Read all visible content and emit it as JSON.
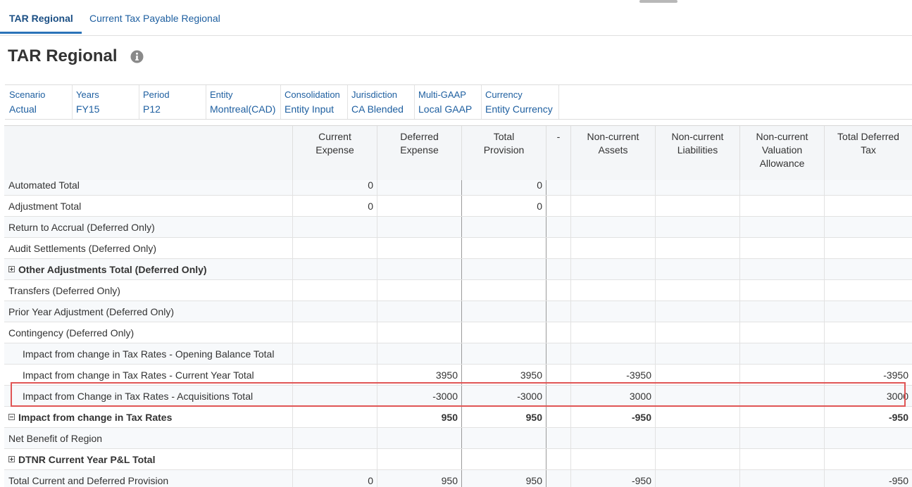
{
  "tabs": [
    {
      "label": "TAR Regional",
      "active": true
    },
    {
      "label": "Current Tax Payable Regional",
      "active": false
    }
  ],
  "page_title": "TAR Regional",
  "pov": [
    {
      "label": "Scenario",
      "value": "Actual"
    },
    {
      "label": "Years",
      "value": "FY15"
    },
    {
      "label": "Period",
      "value": "P12"
    },
    {
      "label": "Entity",
      "value": "Montreal(CAD)"
    },
    {
      "label": "Consolidation",
      "value": "Entity Input"
    },
    {
      "label": "Jurisdiction",
      "value": "CA Blended"
    },
    {
      "label": "Multi-GAAP",
      "value": "Local GAAP"
    },
    {
      "label": "Currency",
      "value": "Entity Currency"
    }
  ],
  "columns": [
    {
      "label": "Current\nExpense"
    },
    {
      "label": "Deferred\nExpense"
    },
    {
      "label": "Total\nProvision"
    },
    {
      "label": "-"
    },
    {
      "label": "Non-current\nAssets"
    },
    {
      "label": "Non-current\nLiabilities"
    },
    {
      "label": "Non-current\nValuation\nAllowance"
    },
    {
      "label": "Total Deferred\nTax"
    }
  ],
  "rows": [
    {
      "label": "Automated Total",
      "values": [
        "0",
        "",
        "0",
        "",
        "",
        "",
        "",
        ""
      ]
    },
    {
      "label": "Adjustment Total",
      "values": [
        "0",
        "",
        "0",
        "",
        "",
        "",
        "",
        ""
      ]
    },
    {
      "label": "Return to Accrual (Deferred Only)",
      "values": [
        "",
        "",
        "",
        "",
        "",
        "",
        "",
        ""
      ]
    },
    {
      "label": "Audit Settlements (Deferred Only)",
      "values": [
        "",
        "",
        "",
        "",
        "",
        "",
        "",
        ""
      ]
    },
    {
      "label": "Other Adjustments Total (Deferred Only)",
      "bold": true,
      "expander": "plus",
      "values": [
        "",
        "",
        "",
        "",
        "",
        "",
        "",
        ""
      ]
    },
    {
      "label": "Transfers (Deferred Only)",
      "values": [
        "",
        "",
        "",
        "",
        "",
        "",
        "",
        ""
      ]
    },
    {
      "label": "Prior Year Adjustment (Deferred Only)",
      "values": [
        "",
        "",
        "",
        "",
        "",
        "",
        "",
        ""
      ]
    },
    {
      "label": "Contingency (Deferred Only)",
      "values": [
        "",
        "",
        "",
        "",
        "",
        "",
        "",
        ""
      ]
    },
    {
      "label": "Impact from change in Tax Rates - Opening Balance Total",
      "indent": true,
      "values": [
        "",
        "",
        "",
        "",
        "",
        "",
        "",
        ""
      ]
    },
    {
      "label": "Impact from change in Tax Rates - Current Year Total",
      "indent": true,
      "values": [
        "",
        "3950",
        "3950",
        "",
        "-3950",
        "",
        "",
        "-3950"
      ]
    },
    {
      "label": "Impact from Change in Tax Rates - Acquisitions Total",
      "indent": true,
      "highlighted": true,
      "values": [
        "",
        "-3000",
        "-3000",
        "",
        "3000",
        "",
        "",
        "3000"
      ]
    },
    {
      "label": "Impact from change in Tax Rates",
      "bold": true,
      "expander": "minus",
      "values": [
        "",
        "950",
        "950",
        "",
        "-950",
        "",
        "",
        "-950"
      ]
    },
    {
      "label": "Net Benefit of Region",
      "values": [
        "",
        "",
        "",
        "",
        "",
        "",
        "",
        ""
      ]
    },
    {
      "label": "DTNR Current Year P&L Total",
      "bold": true,
      "expander": "plus",
      "values": [
        "",
        "",
        "",
        "",
        "",
        "",
        "",
        ""
      ]
    },
    {
      "label": "Total Current and Deferred Provision",
      "values": [
        "0",
        "950",
        "950",
        "",
        "-950",
        "",
        "",
        "-950"
      ]
    }
  ],
  "colors": {
    "link": "#1e5fa0",
    "highlight": "#e05555"
  }
}
